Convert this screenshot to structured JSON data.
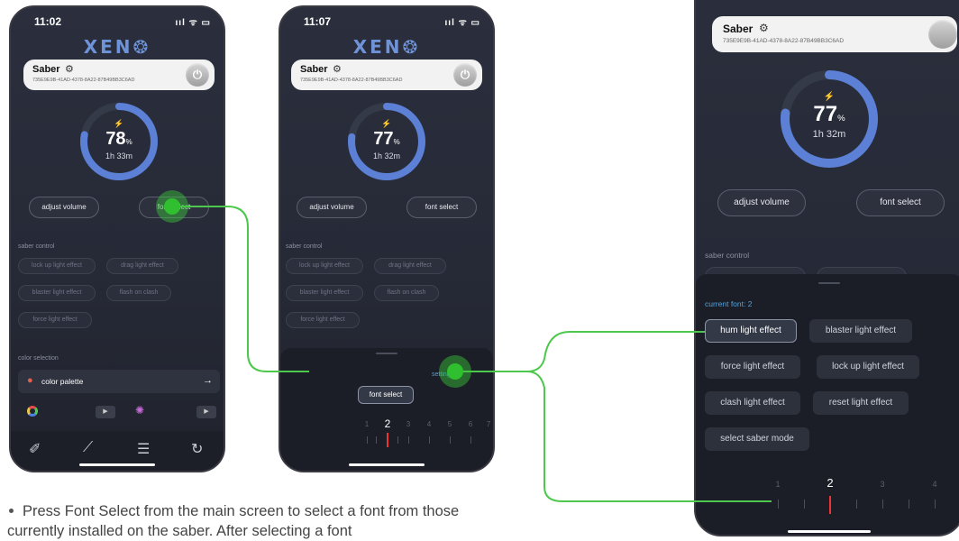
{
  "phone1": {
    "time": "11:02",
    "status_icons": "ııl ᯤ ▭",
    "logo": "XEN❂",
    "saber_name": "Saber",
    "saber_id": "735E9E9B-41AD-4378-8A22-87B49BB3C6AD",
    "battery_percent": "78",
    "battery_level": 0.78,
    "percent_sign": "%",
    "time_left": "1h 33m",
    "adjust_volume": "adjust volume",
    "font_select": "font select",
    "saber_control_label": "saber control",
    "controls": [
      "lock up light effect",
      "drag light effect",
      "blaster light effect",
      "flash on clash",
      "force light effect"
    ],
    "color_selection_label": "color selection",
    "color_palette": "color palette",
    "arrow": "→"
  },
  "phone2": {
    "time": "11:07",
    "status_icons": "ııl ᯤ ▭",
    "logo": "XEN❂",
    "saber_name": "Saber",
    "saber_id": "735E9E9B-41AD-4378-8A22-87B49BB3C6AD",
    "battery_percent": "77",
    "battery_level": 0.77,
    "percent_sign": "%",
    "time_left": "1h 32m",
    "adjust_volume": "adjust volume",
    "font_select": "font select",
    "saber_control_label": "saber control",
    "controls": [
      "lock up light effect",
      "drag light effect",
      "blaster light effect",
      "flash on clash",
      "force light effect"
    ],
    "sheet_link": "settings",
    "sheet_font_select": "font select",
    "font_numbers": [
      "1",
      "2",
      "3",
      "4",
      "5",
      "6",
      "7"
    ],
    "selected_font": "2"
  },
  "phone3": {
    "saber_name": "Saber",
    "saber_id": "735E9E9B-41AD-4378-8A22-87B49BB3C6AD",
    "battery_percent": "77",
    "battery_level": 0.77,
    "percent_sign": "%",
    "time_left": "1h 32m",
    "adjust_volume": "adjust volume",
    "font_select": "font select",
    "saber_control_label": "saber control",
    "current_font": "current font: 2",
    "options": [
      "hum light effect",
      "blaster light effect",
      "force light effect",
      "lock up light effect",
      "clash light effect",
      "reset light effect",
      "select saber mode"
    ],
    "selected_option": "hum light effect",
    "font_numbers": [
      "1",
      "2",
      "3",
      "4"
    ],
    "selected_font": "2"
  },
  "colors": {
    "accent": "#5b80d6",
    "touch": "#2fbf2f",
    "connector": "#4cc94c"
  },
  "caption": "Press Font Select from the main screen to select a font from those currently installed on the saber. After selecting a font"
}
